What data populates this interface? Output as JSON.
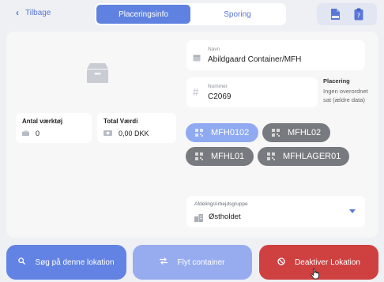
{
  "header": {
    "back_label": "Tilbage",
    "tabs": [
      {
        "label": "Placeringsinfo",
        "active": true
      },
      {
        "label": "Sporing",
        "active": false
      }
    ],
    "icons": [
      "pdf-icon",
      "clipboard-icon"
    ]
  },
  "stats": {
    "tools": {
      "label": "Antal værktøj",
      "value": "0"
    },
    "total_value": {
      "label": "Total Værdi",
      "value": "0,00 DKK"
    }
  },
  "fields": {
    "name": {
      "label": "Navn",
      "value": "Abildgaard Container/MFH"
    },
    "number": {
      "label": "Nummer",
      "value": "C2069"
    }
  },
  "placement": {
    "title": "Placering",
    "value": "Ingen overordnet sat (ældre data)"
  },
  "chips": [
    {
      "label": "MFH0102",
      "selected": true
    },
    {
      "label": "MFHL02",
      "selected": false
    },
    {
      "label": "MFHL01",
      "selected": false
    },
    {
      "label": "MFHLAGER01",
      "selected": false
    }
  ],
  "department": {
    "label": "Afdeling/Arbejdsgruppe",
    "value": "Østholdet"
  },
  "actions": {
    "search": "Søg på denne lokation",
    "move": "Flyt container",
    "deactivate": "Deaktiver Lokation"
  },
  "colors": {
    "accent": "#5f82e0",
    "chip_selected": "#8faaf0",
    "chip": "#777a7e",
    "danger": "#cf4141"
  }
}
